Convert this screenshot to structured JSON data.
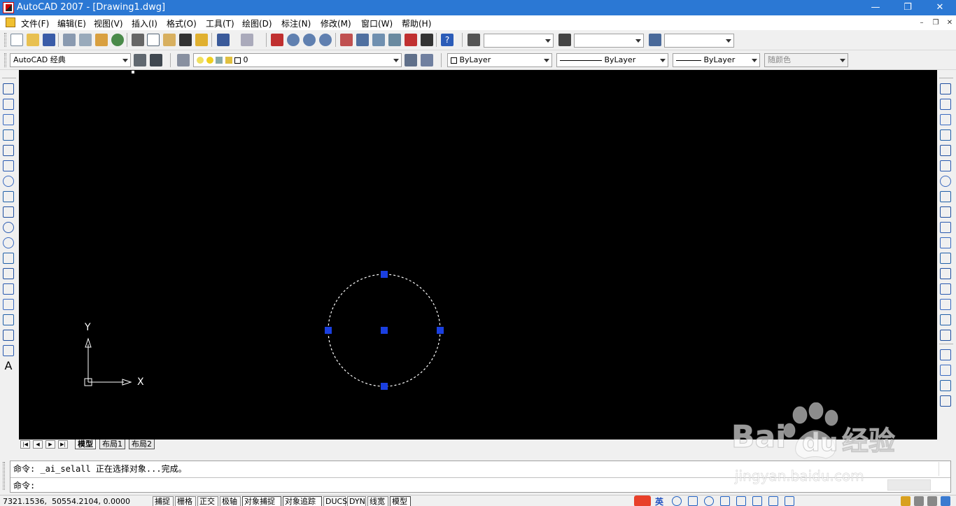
{
  "window": {
    "title": "AutoCAD 2007 - [Drawing1.dwg]",
    "minimize": "—",
    "maximize": "❐",
    "close": "✕"
  },
  "menubar": {
    "items": [
      "文件(F)",
      "编辑(E)",
      "视图(V)",
      "插入(I)",
      "格式(O)",
      "工具(T)",
      "绘图(D)",
      "标注(N)",
      "修改(M)",
      "窗口(W)",
      "帮助(H)"
    ],
    "mdi_min": "–",
    "mdi_restore": "❐",
    "mdi_close": "✕"
  },
  "toolbar2": {
    "workspace": "AutoCAD 经典",
    "layer": "0",
    "color": "ByLayer",
    "linetype": "ByLayer",
    "lineweight": "ByLayer",
    "plotstyle": "随颜色"
  },
  "layout_tabs": {
    "tabs": [
      "模型",
      "布局1",
      "布局2"
    ],
    "active": "模型",
    "nav": [
      "|◀",
      "◀",
      "▶",
      "▶|"
    ]
  },
  "command": {
    "history": "命令: _ai_selall 正在选择对象...完成。",
    "prompt": "命令:"
  },
  "ucs": {
    "x_label": "X",
    "y_label": "Y"
  },
  "statusbar": {
    "coords": "7321.1536,  50554.2104, 0.0000",
    "toggles": [
      "捕捉",
      "栅格",
      "正交",
      "极轴",
      "对象捕捉",
      "对象追踪",
      "DUCS",
      "DYN",
      "线宽",
      "模型"
    ],
    "pressed": [
      "对象捕捉",
      "对象追踪",
      "模型"
    ],
    "ime_label": "英"
  },
  "colors": {
    "canvas": "#000000",
    "grip": "#1a3fe0",
    "titlebar": "#2b78d4"
  },
  "icons": {
    "draw_toolbar": [
      "line-icon",
      "construction-line-icon",
      "polyline-icon",
      "polygon-icon",
      "rectangle-icon",
      "arc-icon",
      "circle-icon",
      "revision-cloud-icon",
      "spline-icon",
      "ellipse-icon",
      "ellipse-arc-icon",
      "insert-block-icon",
      "make-block-icon",
      "point-icon",
      "hatch-icon",
      "gradient-icon",
      "region-icon",
      "table-icon",
      "multiline-text-icon"
    ],
    "modify_toolbar": [
      "erase-icon",
      "copy-icon",
      "mirror-icon",
      "offset-icon",
      "array-icon",
      "move-icon",
      "rotate-icon",
      "scale-icon",
      "stretch-icon",
      "trim-icon",
      "extend-icon",
      "break-at-point-icon",
      "break-icon",
      "join-icon",
      "chamfer-icon",
      "fillet-icon",
      "explode-icon",
      "draworder-front-icon",
      "draworder-back-icon",
      "draworder-above-icon",
      "draworder-under-icon"
    ]
  },
  "watermark": {
    "brand": "Bai",
    "brand2": "du",
    "cn": "经验",
    "url": "jingyan.baidu.com"
  }
}
